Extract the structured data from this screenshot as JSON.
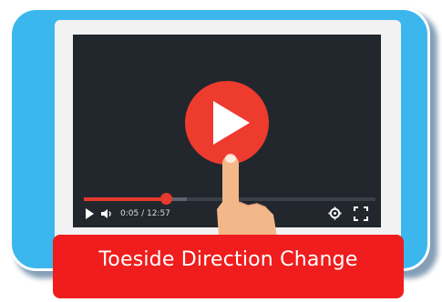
{
  "player": {
    "time_display": "0:05 / 12:57",
    "progress": {
      "played_fraction": 0.28,
      "buffered_fraction": 0.35
    }
  },
  "caption": {
    "title": "Toeside Direction Change"
  },
  "icons": {
    "play_overlay": "play-icon",
    "play_control": "play-icon",
    "volume": "volume-icon",
    "settings": "gear-icon",
    "fullscreen": "fullscreen-icon"
  },
  "colors": {
    "frame": "#3cb7ee",
    "accent": "#ed3b2e",
    "screen": "#22262d",
    "caption_bar": "#ef1d1d"
  }
}
